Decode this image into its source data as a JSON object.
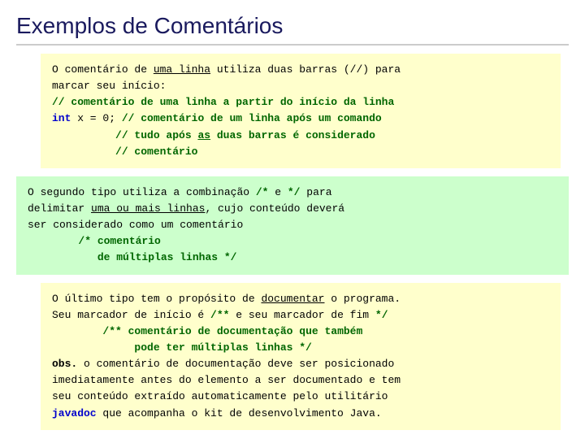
{
  "title": "Exemplos de Comentários",
  "section1": {
    "bg": "#ffffcc",
    "line1": "O comentário de uma linha utiliza duas barras (//) para",
    "line1_underline": "uma linha",
    "line2": "marcar seu início:",
    "line3_prefix": "// ",
    "line3_text": "comentário de uma linha a partir do início da linha",
    "line4_prefix": "int x = 0; // ",
    "line4_text": "comentário de um linha após um comando",
    "line5": "// tudo após as duas barras é considerado",
    "line6": "// comentário"
  },
  "section2": {
    "bg": "#ccffcc",
    "line1_pre": "O segundo tipo utiliza a combinação ",
    "line1_bold1": "/*",
    "line1_mid": " e ",
    "line1_bold2": "*/",
    "line1_post": " para",
    "line2_pre": "delimitar ",
    "line2_underline": "uma ou mais linhas",
    "line2_post": ", cujo conteúdo deverá",
    "line3": "ser considerado como um comentário",
    "line4": "        /* comentário",
    "line5": "           de múltiplas linhas */"
  },
  "section3": {
    "bg": "#ffffcc",
    "line1_pre": "O último tipo tem o propósito de ",
    "line1_underline": "documentar",
    "line1_post": " o programa.",
    "line2_pre": "Seu marcador de início é ",
    "line2_bold1": "/**",
    "line2_mid": " e seu marcador de fim ",
    "line2_bold2": "*/",
    "line3": "        /** comentário de documentação que também",
    "line4": "             pode ter múltiplas linhas */",
    "line5_bold": "obs.",
    "line5_post": " o comentário de documentação deve ser posicionado",
    "line6": "imediatamente antes do elemento a ser documentado e tem",
    "line7": "seu conteúdo extraído automaticamente pelo utilitário",
    "line8_bold": "javadoc",
    "line8_post": " que acompanha o kit de desenvolvimento Java."
  }
}
